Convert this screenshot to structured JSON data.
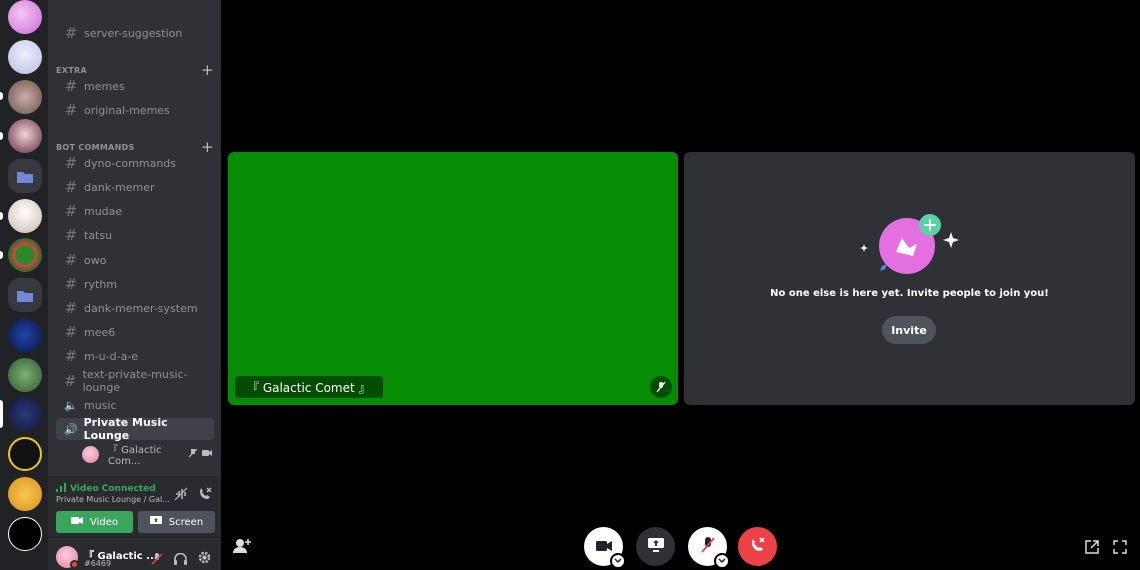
{
  "sidebar": {
    "top_channel": "server-suggestion",
    "categories": [
      {
        "label": "EXTRA",
        "channels": [
          "memes",
          "original-memes"
        ]
      },
      {
        "label": "BOT COMMANDS",
        "channels": [
          "dyno-commands",
          "dank-memer",
          "mudae",
          "tatsu",
          "owo",
          "rythm",
          "dank-memer-system",
          "mee6",
          "m-u-d-a-e",
          "text-private-music-lounge"
        ]
      }
    ],
    "voice_channels": [
      "music",
      "Private Music Lounge"
    ],
    "voice_member": "『 Galactic Com..."
  },
  "voice_panel": {
    "status": "Video Connected",
    "location": "Private Music Lounge / Gal...",
    "video_label": "Video",
    "screen_label": "Screen"
  },
  "user": {
    "name": "『 Galactic ...",
    "tag": "#6469"
  },
  "stage": {
    "participant_name": "『 Galactic Comet 』",
    "empty_message": "No one else is here yet. Invite people to join you!",
    "invite_label": "Invite"
  },
  "colors": {
    "video_tile": "#078c05",
    "connected": "#3ba55d",
    "danger": "#ed4245",
    "accent": "#3ba55d"
  }
}
